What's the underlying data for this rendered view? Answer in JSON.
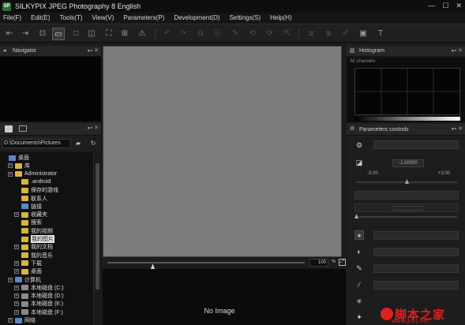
{
  "window": {
    "title": "SILKYPIX JPEG Photography 8 English",
    "app_icon": "SP",
    "controls": [
      "—",
      "☐",
      "✕"
    ]
  },
  "menu": [
    "File(F)",
    "Edit(E)",
    "Tools(T)",
    "View(V)",
    "Parameters(P)",
    "Development(D)",
    "Settings(S)",
    "Help(H)"
  ],
  "navigator": {
    "title": "Navigator"
  },
  "browser": {
    "path": "D:\\Documents\\Pictures",
    "tree": [
      {
        "label": "桌面",
        "level": 0,
        "icon": "blue"
      },
      {
        "label": "库",
        "level": 1,
        "icon": "folder",
        "expandable": true
      },
      {
        "label": "Administrator",
        "level": 1,
        "icon": "folder",
        "expandable": true
      },
      {
        "label": ".android",
        "level": 2,
        "icon": "folder"
      },
      {
        "label": "保存的游戏",
        "level": 2,
        "icon": "folder"
      },
      {
        "label": "联系人",
        "level": 2,
        "icon": "folder"
      },
      {
        "label": "链接",
        "level": 2,
        "icon": "blue"
      },
      {
        "label": "收藏夹",
        "level": 2,
        "icon": "folder",
        "expandable": true
      },
      {
        "label": "搜索",
        "level": 2,
        "icon": "folder"
      },
      {
        "label": "我的视频",
        "level": 2,
        "icon": "folder"
      },
      {
        "label": "我的图片",
        "level": 2,
        "icon": "folder",
        "selected": true
      },
      {
        "label": "我的文档",
        "level": 2,
        "icon": "folder",
        "expandable": true
      },
      {
        "label": "我的音乐",
        "level": 2,
        "icon": "folder"
      },
      {
        "label": "下载",
        "level": 2,
        "icon": "folder",
        "expandable": true
      },
      {
        "label": "桌面",
        "level": 2,
        "icon": "folder",
        "expandable": true
      },
      {
        "label": "计算机",
        "level": 1,
        "icon": "blue",
        "expandable": true
      },
      {
        "label": "本地磁盘 (C:)",
        "level": 2,
        "icon": "drive",
        "expandable": true
      },
      {
        "label": "本地磁盘 (D:)",
        "level": 2,
        "icon": "drive",
        "expandable": true
      },
      {
        "label": "本地磁盘 (E:)",
        "level": 2,
        "icon": "drive",
        "expandable": true
      },
      {
        "label": "本地磁盘 (F:)",
        "level": 2,
        "icon": "drive",
        "expandable": true
      },
      {
        "label": "网络",
        "level": 1,
        "icon": "blue",
        "expandable": true
      }
    ]
  },
  "preview": {
    "zoom_value": "100",
    "zoom_unit": "%",
    "zoom_level": 0.23
  },
  "thumbnails": {
    "empty_text": "No Image"
  },
  "histogram": {
    "title": "Histogram",
    "channel": "All channels"
  },
  "parameters": {
    "title": "Parameters controls",
    "exposure_value": "-1.00000",
    "range_min": "-3.00",
    "range_max": "+3.00",
    "exposure_level": 0.5
  },
  "watermark": {
    "site_name": "脚本之家",
    "url": "www.jb51.net"
  }
}
